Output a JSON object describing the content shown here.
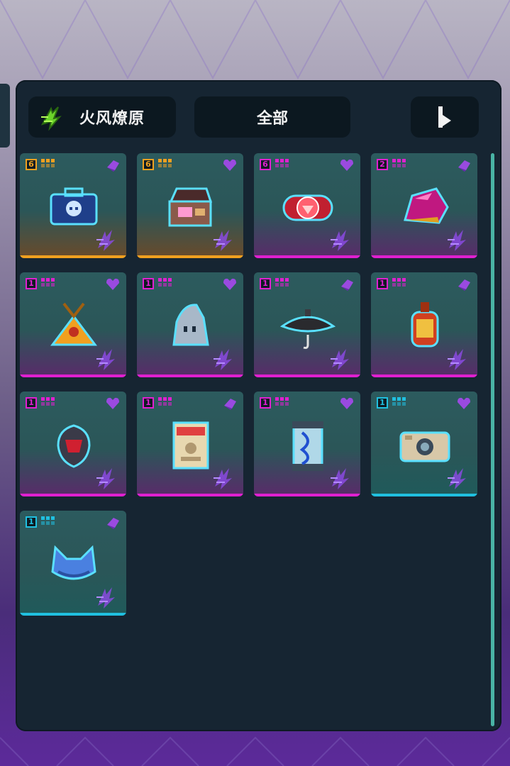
{
  "header": {
    "element_label": "火风燎原",
    "element_icon": "wind-fire-element-icon",
    "filter_label": "全部",
    "sort_icon": "sort-arrow-icon"
  },
  "colors": {
    "orange_rarity": "#f0a020",
    "pink_rarity": "#e020d0",
    "cyan_rarity": "#20c0e0",
    "panel": "#162532"
  },
  "items": [
    {
      "count": "6",
      "rarity": "orange",
      "corner": "gem-icon",
      "art": "skull-briefcase-icon"
    },
    {
      "count": "6",
      "rarity": "orange",
      "corner": "heart-icon",
      "art": "treasure-chest-icon"
    },
    {
      "count": "6",
      "rarity": "pink",
      "corner": "heart-icon",
      "art": "red-gem-emblem-icon"
    },
    {
      "count": "2",
      "rarity": "pink",
      "corner": "gem-icon",
      "art": "pink-crystal-icon"
    },
    {
      "count": "1",
      "rarity": "pink",
      "corner": "heart-icon",
      "art": "gold-pendant-icon"
    },
    {
      "count": "1",
      "rarity": "pink",
      "corner": "heart-icon",
      "art": "ghost-hat-icon"
    },
    {
      "count": "1",
      "rarity": "pink",
      "corner": "gem-icon",
      "art": "dark-umbrella-icon"
    },
    {
      "count": "1",
      "rarity": "pink",
      "corner": "gem-icon",
      "art": "red-lantern-icon"
    },
    {
      "count": "1",
      "rarity": "pink",
      "corner": "heart-icon",
      "art": "red-shield-icon"
    },
    {
      "count": "1",
      "rarity": "pink",
      "corner": "gem-icon",
      "art": "wanted-poster-icon"
    },
    {
      "count": "1",
      "rarity": "pink",
      "corner": "heart-icon",
      "art": "dna-capsule-icon"
    },
    {
      "count": "1",
      "rarity": "cyan",
      "corner": "heart-icon",
      "art": "camera-box-icon"
    },
    {
      "count": "1",
      "rarity": "cyan",
      "corner": "gem-icon",
      "art": "blue-cat-hat-icon"
    }
  ]
}
